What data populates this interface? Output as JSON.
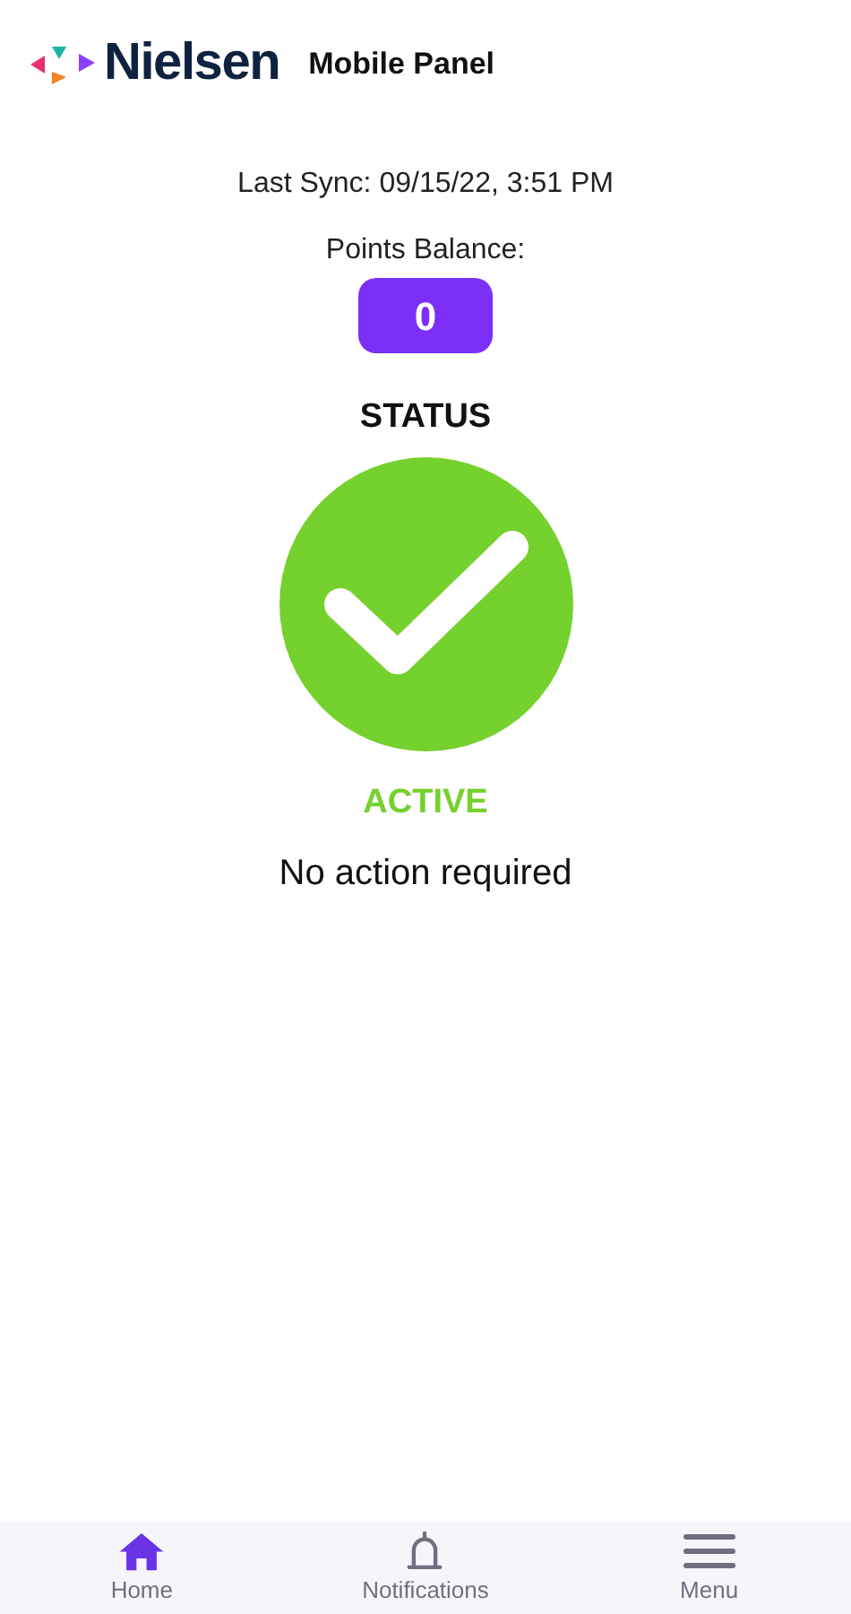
{
  "header": {
    "brand": "Nielsen",
    "title": "Mobile Panel"
  },
  "last_sync": "Last Sync: 09/15/22, 3:51 PM",
  "points": {
    "label": "Points Balance:",
    "value": "0"
  },
  "status": {
    "heading": "STATUS",
    "kind": "active",
    "label": "ACTIVE",
    "message": "No action required"
  },
  "nav": [
    {
      "kind": "home",
      "label": "Home",
      "selected": true
    },
    {
      "kind": "bell",
      "label": "Notifications",
      "selected": false
    },
    {
      "kind": "menu",
      "label": "Menu",
      "selected": false
    }
  ]
}
